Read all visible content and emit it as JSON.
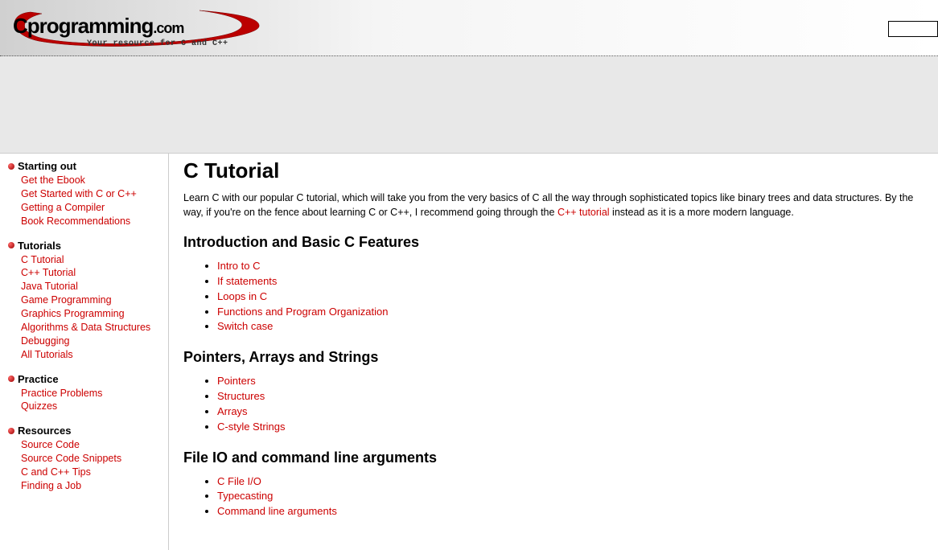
{
  "logo": {
    "main": "Cprogramming",
    "suffix": ".com",
    "tagline": "Your resource for  C and C++"
  },
  "sidebar": [
    {
      "title": "Starting out",
      "links": [
        "Get the Ebook",
        "Get Started with C or C++",
        "Getting a Compiler",
        "Book Recommendations"
      ]
    },
    {
      "title": "Tutorials",
      "links": [
        "C Tutorial",
        "C++ Tutorial",
        "Java Tutorial",
        "Game Programming",
        "Graphics Programming",
        "Algorithms & Data Structures",
        "Debugging",
        "All Tutorials"
      ]
    },
    {
      "title": "Practice",
      "links": [
        "Practice Problems",
        "Quizzes"
      ]
    },
    {
      "title": "Resources",
      "links": [
        "Source Code",
        "Source Code Snippets",
        "C and C++ Tips",
        "Finding a Job"
      ]
    }
  ],
  "main": {
    "title": "C Tutorial",
    "intro_before": "Learn C with our popular C tutorial, which will take you from the very basics of C all the way through sophisticated topics like binary trees and data structures. By the way, if you're on the fence about learning C or C++, I recommend going through the ",
    "intro_link": "C++ tutorial",
    "intro_after": " instead as it is a more modern language.",
    "sections": [
      {
        "heading": "Introduction and Basic C Features",
        "links": [
          "Intro to C",
          "If statements",
          "Loops in C",
          "Functions and Program Organization",
          "Switch case"
        ]
      },
      {
        "heading": "Pointers, Arrays and Strings",
        "links": [
          "Pointers",
          "Structures",
          "Arrays",
          "C-style Strings"
        ]
      },
      {
        "heading": "File IO and command line arguments",
        "links": [
          "C File I/O",
          "Typecasting",
          "Command line arguments"
        ]
      }
    ]
  }
}
